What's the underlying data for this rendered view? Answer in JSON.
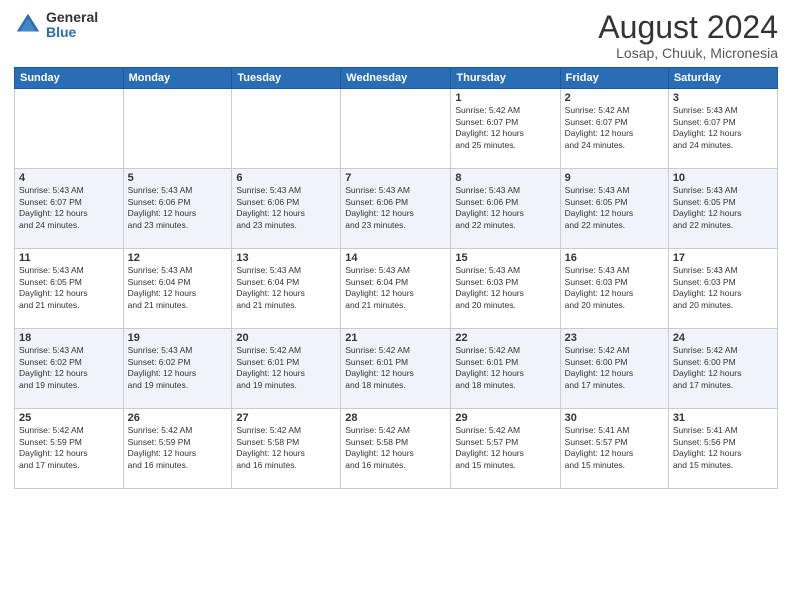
{
  "logo": {
    "general": "General",
    "blue": "Blue"
  },
  "title": "August 2024",
  "subtitle": "Losap, Chuuk, Micronesia",
  "days_header": [
    "Sunday",
    "Monday",
    "Tuesday",
    "Wednesday",
    "Thursday",
    "Friday",
    "Saturday"
  ],
  "weeks": [
    [
      {
        "day": "",
        "info": ""
      },
      {
        "day": "",
        "info": ""
      },
      {
        "day": "",
        "info": ""
      },
      {
        "day": "",
        "info": ""
      },
      {
        "day": "1",
        "info": "Sunrise: 5:42 AM\nSunset: 6:07 PM\nDaylight: 12 hours\nand 25 minutes."
      },
      {
        "day": "2",
        "info": "Sunrise: 5:42 AM\nSunset: 6:07 PM\nDaylight: 12 hours\nand 24 minutes."
      },
      {
        "day": "3",
        "info": "Sunrise: 5:43 AM\nSunset: 6:07 PM\nDaylight: 12 hours\nand 24 minutes."
      }
    ],
    [
      {
        "day": "4",
        "info": "Sunrise: 5:43 AM\nSunset: 6:07 PM\nDaylight: 12 hours\nand 24 minutes."
      },
      {
        "day": "5",
        "info": "Sunrise: 5:43 AM\nSunset: 6:06 PM\nDaylight: 12 hours\nand 23 minutes."
      },
      {
        "day": "6",
        "info": "Sunrise: 5:43 AM\nSunset: 6:06 PM\nDaylight: 12 hours\nand 23 minutes."
      },
      {
        "day": "7",
        "info": "Sunrise: 5:43 AM\nSunset: 6:06 PM\nDaylight: 12 hours\nand 23 minutes."
      },
      {
        "day": "8",
        "info": "Sunrise: 5:43 AM\nSunset: 6:06 PM\nDaylight: 12 hours\nand 22 minutes."
      },
      {
        "day": "9",
        "info": "Sunrise: 5:43 AM\nSunset: 6:05 PM\nDaylight: 12 hours\nand 22 minutes."
      },
      {
        "day": "10",
        "info": "Sunrise: 5:43 AM\nSunset: 6:05 PM\nDaylight: 12 hours\nand 22 minutes."
      }
    ],
    [
      {
        "day": "11",
        "info": "Sunrise: 5:43 AM\nSunset: 6:05 PM\nDaylight: 12 hours\nand 21 minutes."
      },
      {
        "day": "12",
        "info": "Sunrise: 5:43 AM\nSunset: 6:04 PM\nDaylight: 12 hours\nand 21 minutes."
      },
      {
        "day": "13",
        "info": "Sunrise: 5:43 AM\nSunset: 6:04 PM\nDaylight: 12 hours\nand 21 minutes."
      },
      {
        "day": "14",
        "info": "Sunrise: 5:43 AM\nSunset: 6:04 PM\nDaylight: 12 hours\nand 21 minutes."
      },
      {
        "day": "15",
        "info": "Sunrise: 5:43 AM\nSunset: 6:03 PM\nDaylight: 12 hours\nand 20 minutes."
      },
      {
        "day": "16",
        "info": "Sunrise: 5:43 AM\nSunset: 6:03 PM\nDaylight: 12 hours\nand 20 minutes."
      },
      {
        "day": "17",
        "info": "Sunrise: 5:43 AM\nSunset: 6:03 PM\nDaylight: 12 hours\nand 20 minutes."
      }
    ],
    [
      {
        "day": "18",
        "info": "Sunrise: 5:43 AM\nSunset: 6:02 PM\nDaylight: 12 hours\nand 19 minutes."
      },
      {
        "day": "19",
        "info": "Sunrise: 5:43 AM\nSunset: 6:02 PM\nDaylight: 12 hours\nand 19 minutes."
      },
      {
        "day": "20",
        "info": "Sunrise: 5:42 AM\nSunset: 6:01 PM\nDaylight: 12 hours\nand 19 minutes."
      },
      {
        "day": "21",
        "info": "Sunrise: 5:42 AM\nSunset: 6:01 PM\nDaylight: 12 hours\nand 18 minutes."
      },
      {
        "day": "22",
        "info": "Sunrise: 5:42 AM\nSunset: 6:01 PM\nDaylight: 12 hours\nand 18 minutes."
      },
      {
        "day": "23",
        "info": "Sunrise: 5:42 AM\nSunset: 6:00 PM\nDaylight: 12 hours\nand 17 minutes."
      },
      {
        "day": "24",
        "info": "Sunrise: 5:42 AM\nSunset: 6:00 PM\nDaylight: 12 hours\nand 17 minutes."
      }
    ],
    [
      {
        "day": "25",
        "info": "Sunrise: 5:42 AM\nSunset: 5:59 PM\nDaylight: 12 hours\nand 17 minutes."
      },
      {
        "day": "26",
        "info": "Sunrise: 5:42 AM\nSunset: 5:59 PM\nDaylight: 12 hours\nand 16 minutes."
      },
      {
        "day": "27",
        "info": "Sunrise: 5:42 AM\nSunset: 5:58 PM\nDaylight: 12 hours\nand 16 minutes."
      },
      {
        "day": "28",
        "info": "Sunrise: 5:42 AM\nSunset: 5:58 PM\nDaylight: 12 hours\nand 16 minutes."
      },
      {
        "day": "29",
        "info": "Sunrise: 5:42 AM\nSunset: 5:57 PM\nDaylight: 12 hours\nand 15 minutes."
      },
      {
        "day": "30",
        "info": "Sunrise: 5:41 AM\nSunset: 5:57 PM\nDaylight: 12 hours\nand 15 minutes."
      },
      {
        "day": "31",
        "info": "Sunrise: 5:41 AM\nSunset: 5:56 PM\nDaylight: 12 hours\nand 15 minutes."
      }
    ]
  ]
}
